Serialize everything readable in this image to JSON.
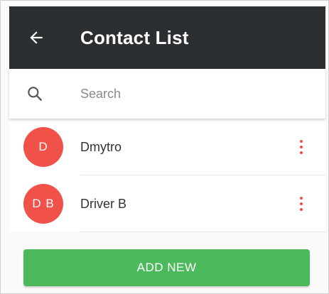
{
  "app_bar": {
    "title": "Contact List",
    "back_icon": "arrow-left-icon",
    "background_color": "#2b2f31"
  },
  "search": {
    "icon": "search-icon",
    "placeholder": "Search",
    "value": ""
  },
  "contacts": [
    {
      "initials": "D",
      "name": "Dmytro",
      "menu_icon": "more-vertical-icon"
    },
    {
      "initials": "D B",
      "name": "Driver B",
      "menu_icon": "more-vertical-icon"
    }
  ],
  "footer": {
    "add_label": "ADD NEW"
  },
  "colors": {
    "accent_red": "#f0524a",
    "accent_green": "#4cba5c"
  }
}
